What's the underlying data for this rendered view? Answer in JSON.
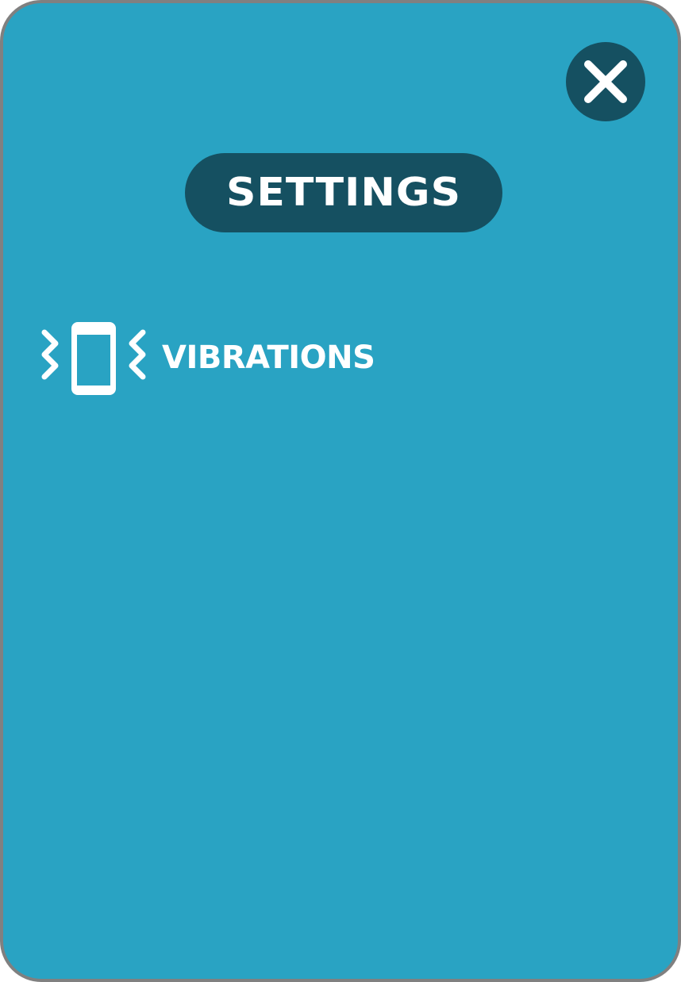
{
  "dialog": {
    "title": "Settings",
    "close_icon": "close-icon",
    "colors": {
      "panel_background": "#29a3c3",
      "panel_border": "#808080",
      "accent_dark": "#155061",
      "text": "#ffffff"
    }
  },
  "settings": {
    "items": [
      {
        "label": "VIBRATIONS",
        "icon": "phone-vibrate-icon"
      }
    ]
  }
}
